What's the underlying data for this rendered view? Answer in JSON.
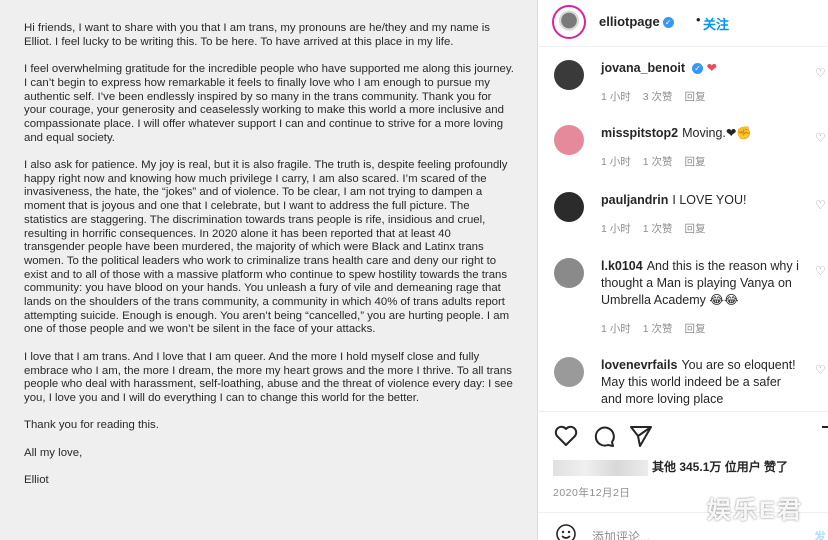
{
  "post": {
    "paragraphs": [
      "Hi friends, I want to share with you that I am trans, my pronouns are he/they and my name is Elliot. I feel lucky to be writing this. To be here. To have arrived at this place in my life.",
      "I feel overwhelming gratitude for the incredible people who have supported me along this journey. I can’t begin to express how remarkable it feels to finally love who I am enough to pursue my authentic self. I’ve been endlessly inspired by so many in the trans community. Thank you for your courage, your generosity and ceaselessly working to make this world a more inclusive and compassionate place. I will offer whatever support I can and continue to strive for a more loving and equal society.",
      "I also ask for patience. My joy is real, but it is also fragile. The truth is, despite feeling profoundly happy right now and knowing how much privilege I carry, I am also scared. I’m scared of the invasiveness, the hate, the “jokes” and of violence. To be clear, I am not trying to dampen a moment that is joyous and one that I celebrate, but I want to address the full picture. The statistics are staggering. The discrimination towards trans people is rife, insidious and cruel, resulting in horrific consequences. In 2020 alone it has been reported that at least 40 transgender people have been murdered, the majority of which were Black and Latinx trans women. To the political leaders who work to criminalize trans health care and deny our right to exist and to all of those with a massive platform who continue to spew hostility towards the trans community: you have blood on your hands. You unleash a fury of vile and demeaning rage that lands on the shoulders of the trans community, a community in which 40% of trans adults report attempting suicide. Enough is enough. You aren’t being “cancelled,” you are hurting people. I am one of those people and we won’t be silent in the face of your attacks.",
      "I love that I am trans. And I love that I am queer. And the more I hold myself close and fully embrace who I am, the more I dream, the more my heart grows and the more I thrive. To all trans people who deal with harassment, self-loathing, abuse and the threat of violence every day: I see you, I love you and I will do everything I can to change this world for the better.",
      "Thank you for reading this.",
      "All my love,",
      "Elliot"
    ]
  },
  "header": {
    "username": "elliotpage",
    "verified_mark": "✓",
    "separator": "•",
    "follow_label": "关注"
  },
  "comments": [
    {
      "user": "jovana_benoit",
      "verified_mark": "✓",
      "text": "❤",
      "time": "1 小时",
      "likes": "3 次赞",
      "reply": "回复",
      "avatar_color": "#3a3a3a"
    },
    {
      "user": "misspitstop2",
      "text": "Moving.❤✊",
      "time": "1 小时",
      "likes": "1 次赞",
      "reply": "回复",
      "avatar_color": "#e58a9b"
    },
    {
      "user": "pauljandrin",
      "text": "I LOVE YOU!",
      "time": "1 小时",
      "likes": "1 次赞",
      "reply": "回复",
      "avatar_color": "#2b2b2b"
    },
    {
      "user": "l.k0104",
      "text": "And this is the reason why i thought a Man is playing Vanya on Umbrella Academy 😂😂",
      "time": "1 小时",
      "likes": "1 次赞",
      "reply": "回复",
      "avatar_color": "#8a8a8a"
    },
    {
      "user": "lovenevrfails",
      "text": "You are so eloquent! May this world indeed be a safer and more loving place",
      "time": "",
      "likes": "",
      "reply": "",
      "avatar_color": "#9a9a9a"
    }
  ],
  "actions": {
    "like_icon": "heart-icon",
    "comment_icon": "comment-icon",
    "share_icon": "share-icon",
    "save_icon": "bookmark-icon"
  },
  "likes_text": "其他 345.1万 位用户 赞了",
  "date": "2020年12月2日",
  "add_comment": {
    "placeholder": "添加评论...",
    "post_label": "发"
  },
  "watermark": "娱乐E君"
}
